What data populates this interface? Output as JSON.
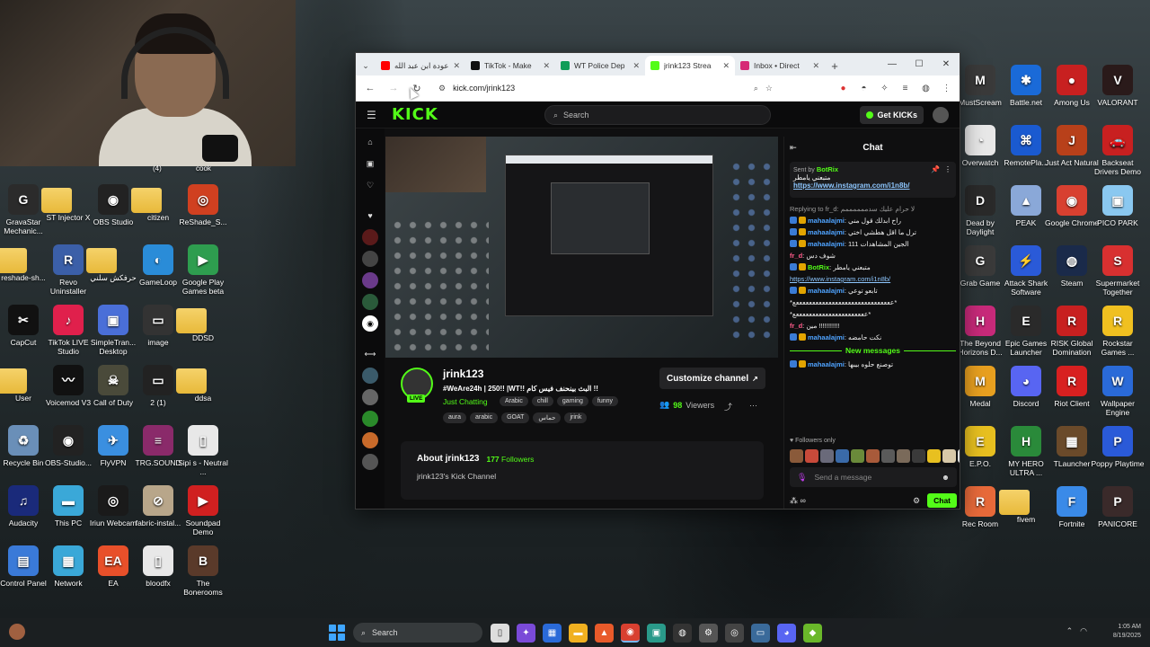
{
  "webcam": {
    "labels": [
      "(4)",
      "cook"
    ]
  },
  "desktop_left": [
    {
      "label": "GravaStar Mechanic...",
      "icon": "gravastar-icon",
      "color": "#2b2b2b",
      "glyph": "G"
    },
    {
      "label": "ST Injector X",
      "icon": "folder-icon",
      "folder": true
    },
    {
      "label": "OBS Studio",
      "icon": "obs-icon",
      "color": "#222",
      "glyph": "◉"
    },
    {
      "label": "citizen",
      "icon": "folder-icon",
      "folder": true
    },
    {
      "label": "ReShade_S...",
      "icon": "reshade-icon",
      "color": "#d04020",
      "glyph": "◎"
    },
    {
      "label": "reshade-sh...",
      "icon": "folder-icon",
      "folder": true
    },
    {
      "label": "Revo Uninstaller",
      "icon": "revo-icon",
      "color": "#3b5fa8",
      "glyph": "R"
    },
    {
      "label": "حرفكش سلني",
      "icon": "folder-icon",
      "folder": true
    },
    {
      "label": "GameLoop",
      "icon": "gameloop-icon",
      "color": "#2a8cd8",
      "glyph": "◐"
    },
    {
      "label": "Google Play Games beta",
      "icon": "google-play-games-icon",
      "color": "#2e9d4f",
      "glyph": "▶"
    },
    {
      "label": "CapCut",
      "icon": "capcut-icon",
      "color": "#111",
      "glyph": "✂"
    },
    {
      "label": "TikTok LIVE Studio",
      "icon": "tiktok-live-icon",
      "color": "#e0204c",
      "glyph": "♪"
    },
    {
      "label": "SimpleTran... Desktop",
      "icon": "simpletrans-icon",
      "color": "#4a6fd8",
      "glyph": "▣"
    },
    {
      "label": "image",
      "icon": "image-file-icon",
      "color": "#333",
      "glyph": "▭"
    },
    {
      "label": "DDSD",
      "icon": "folder-icon",
      "folder": true
    },
    {
      "label": "User",
      "icon": "folder-icon",
      "folder": true
    },
    {
      "label": "Voicemod V3",
      "icon": "voicemod-icon",
      "color": "#111",
      "glyph": "〰"
    },
    {
      "label": "Call of Duty",
      "icon": "call-of-duty-icon",
      "color": "#4a4a3a",
      "glyph": "☠"
    },
    {
      "label": "2 (1)",
      "icon": "image-file-icon",
      "color": "#222",
      "glyph": "▭"
    },
    {
      "label": "ddsa",
      "icon": "folder-icon",
      "folder": true
    },
    {
      "label": "Recycle Bin",
      "icon": "recycle-bin-icon",
      "color": "#6a8fb8",
      "glyph": "♻"
    },
    {
      "label": "OBS-Studio...",
      "icon": "obs-icon",
      "color": "#222",
      "glyph": "◉"
    },
    {
      "label": "FlyVPN",
      "icon": "flyvpn-icon",
      "color": "#3a8fe0",
      "glyph": "✈"
    },
    {
      "label": "TRG.SOUND",
      "icon": "winrar-icon",
      "color": "#8a2a6a",
      "glyph": "≡"
    },
    {
      "label": "Sipi s - Neutral ...",
      "icon": "document-icon",
      "color": "#e8e8e8",
      "glyph": "▯"
    },
    {
      "label": "Audacity",
      "icon": "audacity-icon",
      "color": "#1a2a7a",
      "glyph": "♫"
    },
    {
      "label": "This PC",
      "icon": "this-pc-icon",
      "color": "#3aa8d8",
      "glyph": "▬"
    },
    {
      "label": "Iriun Webcam",
      "icon": "iriun-webcam-icon",
      "color": "#1a1a1a",
      "glyph": "◎"
    },
    {
      "label": "fabric-instal...",
      "icon": "fabric-installer-icon",
      "color": "#b8a68a",
      "glyph": "⊘"
    },
    {
      "label": "Soundpad Demo",
      "icon": "soundpad-icon",
      "color": "#d02020",
      "glyph": "▶"
    },
    {
      "label": "Control Panel",
      "icon": "control-panel-icon",
      "color": "#3a7ad8",
      "glyph": "▤"
    },
    {
      "label": "Network",
      "icon": "network-icon",
      "color": "#3aa8d8",
      "glyph": "▦"
    },
    {
      "label": "EA",
      "icon": "ea-icon",
      "color": "#e8502a",
      "glyph": "EA"
    },
    {
      "label": "bloodfx",
      "icon": "document-icon",
      "color": "#e8e8e8",
      "glyph": "▯"
    },
    {
      "label": "The Bonerooms",
      "icon": "bonerooms-icon",
      "color": "#5a3a2a",
      "glyph": "B"
    }
  ],
  "desktop_right": [
    {
      "label": "MustScream",
      "icon": "mustscream-icon",
      "color": "#3a3a3a",
      "glyph": "M"
    },
    {
      "label": "Battle.net",
      "icon": "battlenet-icon",
      "color": "#1a6ad8",
      "glyph": "✱"
    },
    {
      "label": "Among Us",
      "icon": "among-us-icon",
      "color": "#c82020",
      "glyph": "●"
    },
    {
      "label": "VALORANT",
      "icon": "valorant-icon",
      "color": "#2a1a1a",
      "glyph": "V"
    },
    {
      "label": "Overwatch",
      "icon": "overwatch-icon",
      "color": "#e8e8e8",
      "glyph": "◔"
    },
    {
      "label": "RemotePla...",
      "icon": "remote-play-icon",
      "color": "#1a5ad0",
      "glyph": "⌘"
    },
    {
      "label": "Just Act Natural",
      "icon": "just-act-natural-icon",
      "color": "#b8401a",
      "glyph": "J"
    },
    {
      "label": "Backseat Drivers Demo",
      "icon": "backseat-drivers-icon",
      "color": "#c82020",
      "glyph": "🚗"
    },
    {
      "label": "Dead by Daylight",
      "icon": "dead-by-daylight-icon",
      "color": "#2a2a2a",
      "glyph": "D"
    },
    {
      "label": "PEAK",
      "icon": "peak-icon",
      "color": "#8aa8d8",
      "glyph": "▲"
    },
    {
      "label": "Google Chrome",
      "icon": "chrome-icon",
      "color": "#d84030",
      "glyph": "◉"
    },
    {
      "label": "PICO PARK",
      "icon": "pico-park-icon",
      "color": "#8ac8f0",
      "glyph": "▣"
    },
    {
      "label": "Grab Game",
      "icon": "grab-game-icon",
      "color": "#3a3a3a",
      "glyph": "G"
    },
    {
      "label": "Attack Shark Software",
      "icon": "attack-shark-icon",
      "color": "#2a5ad8",
      "glyph": "⚡"
    },
    {
      "label": "Steam",
      "icon": "steam-icon",
      "color": "#1a2a4a",
      "glyph": "◍"
    },
    {
      "label": "Supermarket Together",
      "icon": "supermarket-together-icon",
      "color": "#d83030",
      "glyph": "S"
    },
    {
      "label": "The Beyond Horizons D...",
      "icon": "beyond-horizons-icon",
      "color": "#c82a7a",
      "glyph": "H"
    },
    {
      "label": "Epic Games Launcher",
      "icon": "epic-games-icon",
      "color": "#2a2a2a",
      "glyph": "E"
    },
    {
      "label": "RISK Global Domination",
      "icon": "risk-icon",
      "color": "#c82020",
      "glyph": "R"
    },
    {
      "label": "Rockstar Games ...",
      "icon": "rockstar-icon",
      "color": "#f0c020",
      "glyph": "R"
    },
    {
      "label": "Medal",
      "icon": "medal-icon",
      "color": "#e8a020",
      "glyph": "M"
    },
    {
      "label": "Discord",
      "icon": "discord-icon",
      "color": "#5865f2",
      "glyph": "◕"
    },
    {
      "label": "Riot Client",
      "icon": "riot-client-icon",
      "color": "#d82020",
      "glyph": "R"
    },
    {
      "label": "Wallpaper Engine",
      "icon": "wallpaper-engine-icon",
      "color": "#2a6ad8",
      "glyph": "W"
    },
    {
      "label": "E.P.O.",
      "icon": "epo-icon",
      "color": "#e8c020",
      "glyph": "E"
    },
    {
      "label": "MY HERO ULTRA ...",
      "icon": "my-hero-icon",
      "color": "#2a8a3a",
      "glyph": "H"
    },
    {
      "label": "TLauncher",
      "icon": "tlauncher-icon",
      "color": "#6a4a2a",
      "glyph": "▦"
    },
    {
      "label": "Poppy Playtime",
      "icon": "poppy-playtime-icon",
      "color": "#2a5ad8",
      "glyph": "P"
    },
    {
      "label": "Rec Room",
      "icon": "rec-room-icon",
      "color": "#e86a3a",
      "glyph": "R"
    },
    {
      "label": "fivem",
      "icon": "folder-icon",
      "folder": true
    },
    {
      "label": "Fortnite",
      "icon": "fortnite-icon",
      "color": "#3a8ae8",
      "glyph": "F"
    },
    {
      "label": "PANICORE",
      "icon": "panicore-icon",
      "color": "#3a2a2a",
      "glyph": "P"
    }
  ],
  "browser": {
    "tabs": [
      {
        "title": "عودة ابن عبد الله",
        "favicon": "youtube-icon",
        "color": "#ff0000",
        "active": false
      },
      {
        "title": "TikTok - Make",
        "favicon": "tiktok-icon",
        "color": "#111111",
        "active": false
      },
      {
        "title": "WT Police Dep",
        "favicon": "sheets-icon",
        "color": "#0f9d58",
        "active": false
      },
      {
        "title": "jrink123 Strea",
        "favicon": "kick-icon",
        "color": "#53fc18",
        "active": true
      },
      {
        "title": "Inbox • Direct",
        "favicon": "instagram-icon",
        "color": "#d62976",
        "active": false
      }
    ],
    "url": "kick.com/jrink123"
  },
  "kick": {
    "logo": "KICK",
    "search_placeholder": "Search",
    "get_kicks": "Get KICKs",
    "streamer": "jrink123",
    "live": "LIVE",
    "title": "#WeAre24h | 250!! |WT!! البث بينحنف فيس كام !!",
    "category": "Just Chatting",
    "tags_row1": [
      "Arabic",
      "chill",
      "gaming",
      "funny"
    ],
    "tags_row2": [
      "aura",
      "arabic",
      "GOAT",
      "حماس",
      "jrink"
    ],
    "customize": "Customize channel",
    "viewers_count": "98",
    "viewers_label": "Viewers",
    "about_title": "About jrink123",
    "followers_count": "177",
    "followers_label": "Followers",
    "about_desc": "jrink123's Kick Channel"
  },
  "chat": {
    "header": "Chat",
    "pinned_sender_label": "Sent by",
    "pinned_sender": "BotRix",
    "pinned_text": "متبعني يامطر",
    "pinned_link": "https://www.instagram.com/i1n8b/",
    "messages": [
      {
        "user": "",
        "text": "Replying to fr_d: لا حرام عليك سدممممممم",
        "kind": "reply"
      },
      {
        "user": "mahaalajmi",
        "text": "راح ابدلك قول مني",
        "kind": "user"
      },
      {
        "user": "mahaalajmi",
        "text": "ترل ما اقل هطشي اختي",
        "kind": "user"
      },
      {
        "user": "mahaalajmi",
        "text": "الجين المشاهدات 111",
        "kind": "user"
      },
      {
        "user": "fr_d",
        "text": "شوف دس",
        "kind": "frd"
      },
      {
        "user": "BotRix",
        "text": "متبعني يامطر",
        "kind": "bot"
      },
      {
        "user": "",
        "text": "https://www.instagram.com/i1n8b/",
        "kind": "link"
      },
      {
        "user": "mahaalajmi",
        "text": "تابعو توعي",
        "kind": "user"
      },
      {
        "user": "",
        "text": "*ععععععععععععععععععععععععععععععع*",
        "kind": "plain"
      },
      {
        "user": "",
        "text": "*ععععععععععععععععععععععع*",
        "kind": "plain"
      },
      {
        "user": "fr_d",
        "text": "مين !!!!!!!!!!!",
        "kind": "frd"
      },
      {
        "user": "mahaalajmi",
        "text": "نكت حامضه",
        "kind": "user"
      }
    ],
    "new_messages": "New messages",
    "after_messages": [
      {
        "user": "mahaalajmi",
        "text": "توصنع حلوه بيبها",
        "kind": "user"
      }
    ],
    "followers_only": "Followers only",
    "input_placeholder": "Send a message",
    "send": "Chat"
  },
  "taskbar": {
    "search": "Search",
    "time": "1:05 AM",
    "date": "8/19/2025"
  }
}
